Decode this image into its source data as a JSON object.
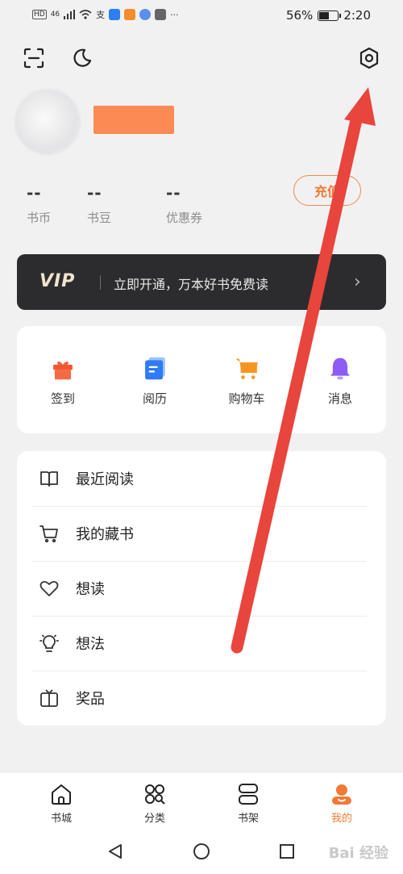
{
  "status_bar": {
    "left_text": "46",
    "battery": "56%",
    "battery_level": 0.56,
    "time": "2:20"
  },
  "header": {
    "scan_icon": "scan-icon",
    "night_icon": "moon-icon",
    "settings_icon": "gear-icon"
  },
  "profile": {
    "stats": [
      {
        "value": "--",
        "label": "书币"
      },
      {
        "value": "--",
        "label": "书豆"
      },
      {
        "value": "--",
        "label": "优惠券"
      }
    ],
    "recharge_label": "充值"
  },
  "vip": {
    "badge": "VIP",
    "text": "立即开通，万本好书免费读",
    "chevron": "›"
  },
  "shortcuts": [
    {
      "label": "签到",
      "icon": "gift-icon",
      "color": "#f2572f"
    },
    {
      "label": "阅历",
      "icon": "document-icon",
      "color": "#2f7bf5"
    },
    {
      "label": "购物车",
      "icon": "cart-icon",
      "color": "#f6961f"
    },
    {
      "label": "消息",
      "icon": "bell-icon",
      "color": "#8d5cf6"
    }
  ],
  "menu": [
    {
      "label": "最近阅读",
      "icon": "book-icon"
    },
    {
      "label": "我的藏书",
      "icon": "cart-outline-icon"
    },
    {
      "label": "想读",
      "icon": "heart-icon"
    },
    {
      "label": "想法",
      "icon": "lightbulb-icon"
    },
    {
      "label": "奖品",
      "icon": "prize-box-icon"
    }
  ],
  "bottom_nav": [
    {
      "label": "书城",
      "icon": "home-icon"
    },
    {
      "label": "分类",
      "icon": "grid-icon"
    },
    {
      "label": "书架",
      "icon": "shelf-icon"
    },
    {
      "label": "我的",
      "icon": "profile-icon"
    }
  ],
  "colors": {
    "accent": "#f07a35",
    "vip_bg": "#2c2c2e",
    "arrow": "#e8453c"
  },
  "watermark": "Bai 经验"
}
